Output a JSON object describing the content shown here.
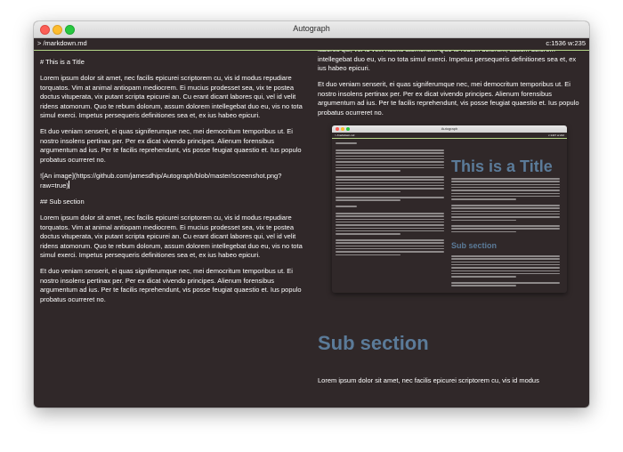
{
  "window": {
    "title": "Autograph"
  },
  "statusbar": {
    "file": "> /markdown.md",
    "cursor_info": "c:1536 w:235"
  },
  "editor": {
    "lines": [
      "# This is a Title",
      "Lorem ipsum dolor sit amet, nec facilis epicurei scriptorem cu, vis id modus repudiare torquatos. Vim at animal antiopam mediocrem. Ei mucius prodesset sea, vix te postea doctus vituperata, vix putant scripta epicurei an. Cu erant dicant labores qui, vel id velit ridens atomorum. Quo te rebum dolorum, assum dolorem intellegebat duo eu, vis no tota simul exerci. Impetus persequeris definitiones sea et, ex ius habeo epicuri.",
      "Et duo veniam senserit, ei quas signiferumque nec, mei democritum temporibus ut. Ei nostro insolens pertinax per. Per ex dicat vivendo principes. Alienum forensibus argumentum ad ius. Per te facilis reprehendunt, vis posse feugiat quaestio et. Ius populo probatus ocurreret no.",
      "![An image](https://github.com/jamesdhip/Autograph/blob/master/screenshot.png?raw=true)",
      "## Sub section",
      "Lorem ipsum dolor sit amet, nec facilis epicurei scriptorem cu, vis id modus repudiare torquatos. Vim at animal antiopam mediocrem. Ei mucius prodesset sea, vix te postea doctus vituperata, vix putant scripta epicurei an. Cu erant dicant labores qui, vel id velit ridens atomorum. Quo te rebum dolorum, assum dolorem intellegebat duo eu, vis no tota simul exerci. Impetus persequeris definitiones sea et, ex ius habeo epicuri.",
      "Et duo veniam senserit, ei quas signiferumque nec, mei democritum temporibus ut. Ei nostro insolens pertinax per. Per ex dicat vivendo principes. Alienum forensibus argumentum ad ius. Per te facilis reprehendunt, vis posse feugiat quaestio et. Ius populo probatus ocurreret no."
    ]
  },
  "preview": {
    "top_paragraph": "labores qui, vel id velit ridens atomorum. Quo te rebum dolorum, assum dolorem intellegebat duo eu, vis no tota simul exerci. Impetus persequeris definitiones sea et, ex ius habeo epicuri.",
    "paragraph_2": "Et duo veniam senserit, ei quas signiferumque nec, mei democritum temporibus ut. Ei nostro insolens pertinax per. Per ex dicat vivendo principes. Alienum forensibus argumentum ad ius. Per te facilis reprehendunt, vis posse feugiat quaestio et. Ius populo probatus ocurreret no.",
    "image": {
      "title": "Autograph",
      "status_left": "> /markdown.md",
      "status_right": "c:1447 w:222",
      "heading": "This is a Title",
      "subheading": "Sub section"
    },
    "sub_heading": "Sub section",
    "bottom_paragraph": "Lorem ipsum dolor sit amet, nec facilis epicurei scriptorem cu, vis id modus"
  },
  "colors": {
    "background": "#302829",
    "text": "#ffffff",
    "heading": "#5b7b99",
    "status_underline": "#b7d98a"
  }
}
